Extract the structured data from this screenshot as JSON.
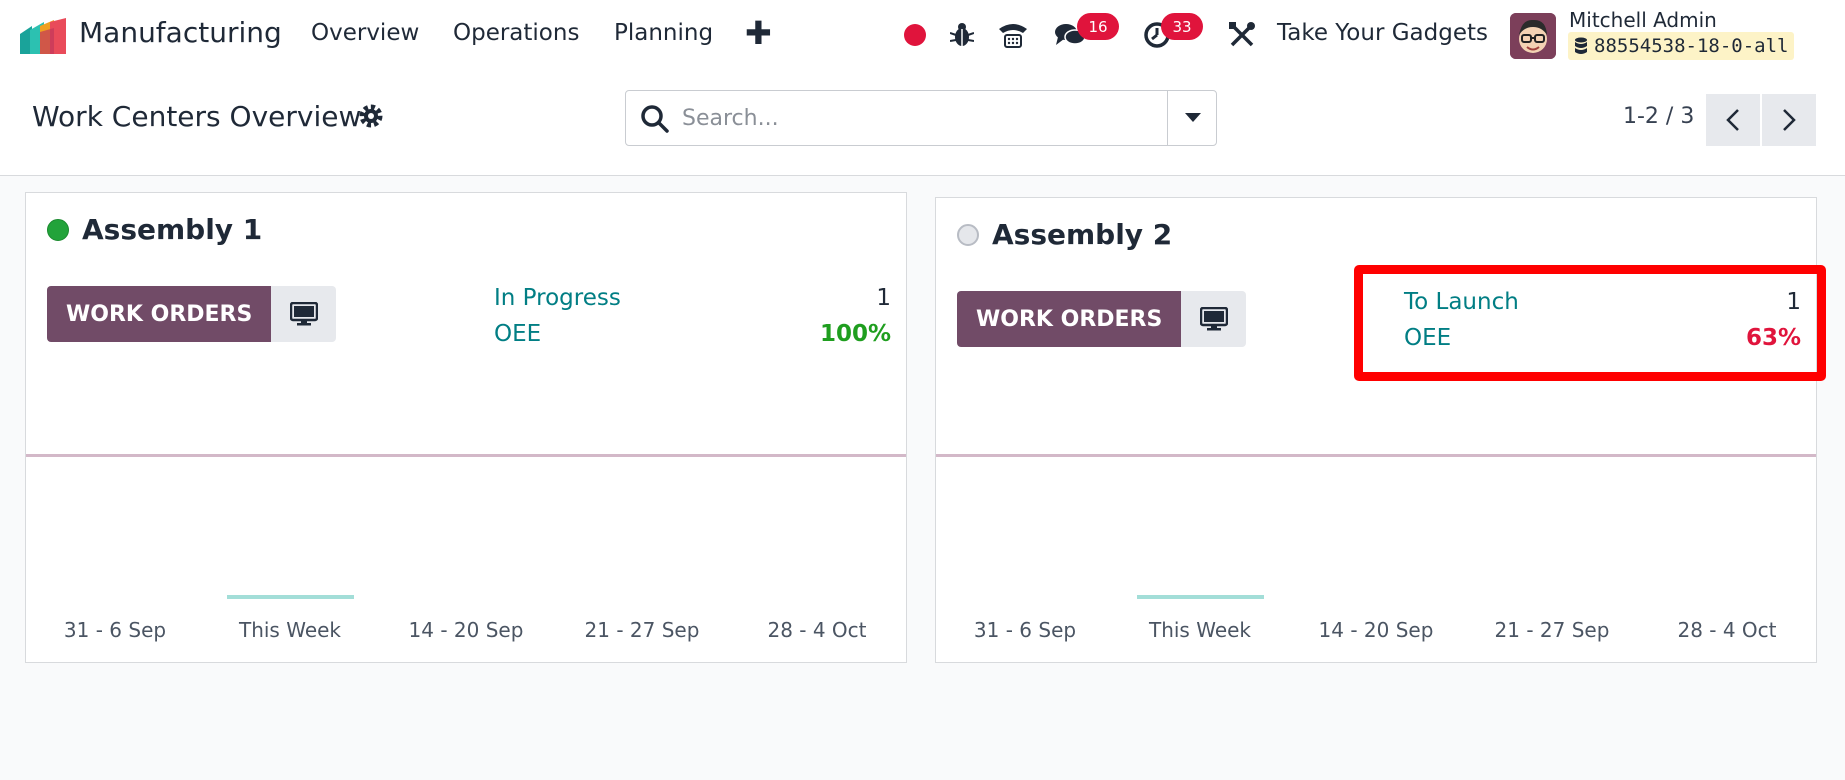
{
  "navbar": {
    "app_name": "Manufacturing",
    "menu": [
      "Overview",
      "Operations",
      "Planning"
    ],
    "add_icon": "plus-icon",
    "messages_count": "16",
    "activities_count": "33",
    "company": "Take Your Gadgets",
    "user_name": "Mitchell Admin",
    "database": "88554538-18-0-all"
  },
  "control_panel": {
    "title": "Work Centers Overview",
    "search_placeholder": "Search...",
    "pager": "1-2 / 3"
  },
  "cards": [
    {
      "name": "Assembly 1",
      "status_color": "#22a33a",
      "button_label": "WORK ORDERS",
      "stat_label": "In Progress",
      "stat_value": "1",
      "oee_label": "OEE",
      "oee_value": "100%",
      "oee_color": "#1f9e1f",
      "weeks": [
        "31 - 6 Sep",
        "This Week",
        "14 - 20 Sep",
        "21 - 27 Sep",
        "28 - 4 Oct"
      ]
    },
    {
      "name": "Assembly 2",
      "status_color": "#e5e7eb",
      "button_label": "WORK ORDERS",
      "stat_label": "To Launch",
      "stat_value": "1",
      "oee_label": "OEE",
      "oee_value": "63%",
      "oee_color": "#e0143c",
      "weeks": [
        "31 - 6 Sep",
        "This Week",
        "14 - 20 Sep",
        "21 - 27 Sep",
        "28 - 4 Oct"
      ]
    }
  ],
  "colors": {
    "brand": "#714b67",
    "link": "#017e84",
    "badge": "#e0143c",
    "highlight": "#ff0000"
  }
}
